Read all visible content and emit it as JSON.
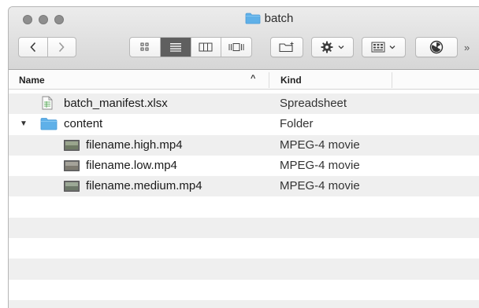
{
  "window": {
    "title": "batch"
  },
  "toolbar": {
    "back_label": "‹",
    "forward_label": "›",
    "view_modes": [
      "icon",
      "list",
      "column",
      "cover-flow"
    ],
    "active_view": "list",
    "overflow_label": "»"
  },
  "columns": {
    "name": "Name",
    "kind": "Kind",
    "sort_indicator": "^"
  },
  "files": [
    {
      "name": "batch_manifest.xlsx",
      "kind": "Spreadsheet",
      "icon": "spreadsheet-icon",
      "indent": 1
    },
    {
      "name": "content",
      "kind": "Folder",
      "icon": "folder-icon",
      "indent": 1,
      "expanded": true
    },
    {
      "name": "filename.high.mp4",
      "kind": "MPEG-4 movie",
      "icon": "video-thumbnail-icon",
      "indent": 2
    },
    {
      "name": "filename.low.mp4",
      "kind": "MPEG-4 movie",
      "icon": "video-thumbnail-icon",
      "indent": 2
    },
    {
      "name": "filename.medium.mp4",
      "kind": "MPEG-4 movie",
      "icon": "video-thumbnail-icon",
      "indent": 2
    }
  ],
  "colors": {
    "folder": "#5fb0e8",
    "active_segment": "#5f5f5f",
    "alt_row": "#efefef"
  }
}
